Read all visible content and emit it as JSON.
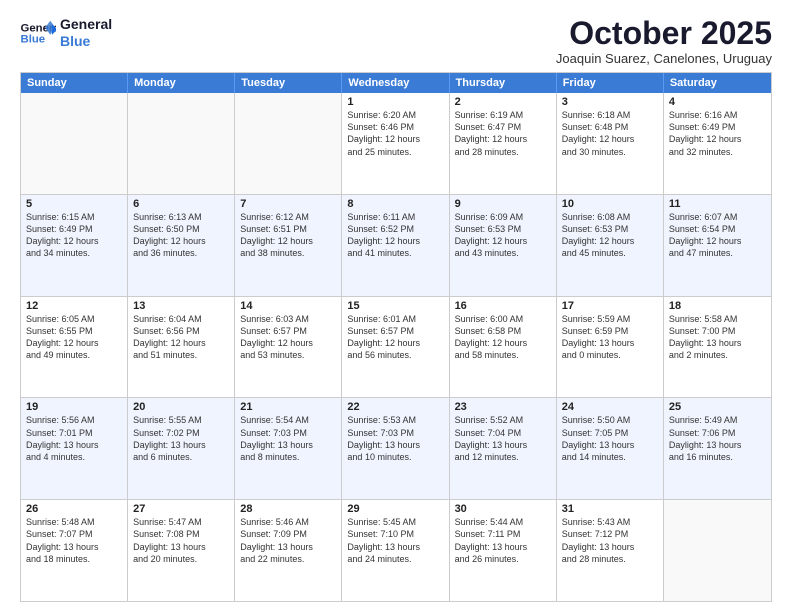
{
  "logo": {
    "line1": "General",
    "line2": "Blue"
  },
  "title": "October 2025",
  "subtitle": "Joaquin Suarez, Canelones, Uruguay",
  "header_days": [
    "Sunday",
    "Monday",
    "Tuesday",
    "Wednesday",
    "Thursday",
    "Friday",
    "Saturday"
  ],
  "weeks": [
    [
      {
        "day": "",
        "info": ""
      },
      {
        "day": "",
        "info": ""
      },
      {
        "day": "",
        "info": ""
      },
      {
        "day": "1",
        "info": "Sunrise: 6:20 AM\nSunset: 6:46 PM\nDaylight: 12 hours\nand 25 minutes."
      },
      {
        "day": "2",
        "info": "Sunrise: 6:19 AM\nSunset: 6:47 PM\nDaylight: 12 hours\nand 28 minutes."
      },
      {
        "day": "3",
        "info": "Sunrise: 6:18 AM\nSunset: 6:48 PM\nDaylight: 12 hours\nand 30 minutes."
      },
      {
        "day": "4",
        "info": "Sunrise: 6:16 AM\nSunset: 6:49 PM\nDaylight: 12 hours\nand 32 minutes."
      }
    ],
    [
      {
        "day": "5",
        "info": "Sunrise: 6:15 AM\nSunset: 6:49 PM\nDaylight: 12 hours\nand 34 minutes."
      },
      {
        "day": "6",
        "info": "Sunrise: 6:13 AM\nSunset: 6:50 PM\nDaylight: 12 hours\nand 36 minutes."
      },
      {
        "day": "7",
        "info": "Sunrise: 6:12 AM\nSunset: 6:51 PM\nDaylight: 12 hours\nand 38 minutes."
      },
      {
        "day": "8",
        "info": "Sunrise: 6:11 AM\nSunset: 6:52 PM\nDaylight: 12 hours\nand 41 minutes."
      },
      {
        "day": "9",
        "info": "Sunrise: 6:09 AM\nSunset: 6:53 PM\nDaylight: 12 hours\nand 43 minutes."
      },
      {
        "day": "10",
        "info": "Sunrise: 6:08 AM\nSunset: 6:53 PM\nDaylight: 12 hours\nand 45 minutes."
      },
      {
        "day": "11",
        "info": "Sunrise: 6:07 AM\nSunset: 6:54 PM\nDaylight: 12 hours\nand 47 minutes."
      }
    ],
    [
      {
        "day": "12",
        "info": "Sunrise: 6:05 AM\nSunset: 6:55 PM\nDaylight: 12 hours\nand 49 minutes."
      },
      {
        "day": "13",
        "info": "Sunrise: 6:04 AM\nSunset: 6:56 PM\nDaylight: 12 hours\nand 51 minutes."
      },
      {
        "day": "14",
        "info": "Sunrise: 6:03 AM\nSunset: 6:57 PM\nDaylight: 12 hours\nand 53 minutes."
      },
      {
        "day": "15",
        "info": "Sunrise: 6:01 AM\nSunset: 6:57 PM\nDaylight: 12 hours\nand 56 minutes."
      },
      {
        "day": "16",
        "info": "Sunrise: 6:00 AM\nSunset: 6:58 PM\nDaylight: 12 hours\nand 58 minutes."
      },
      {
        "day": "17",
        "info": "Sunrise: 5:59 AM\nSunset: 6:59 PM\nDaylight: 13 hours\nand 0 minutes."
      },
      {
        "day": "18",
        "info": "Sunrise: 5:58 AM\nSunset: 7:00 PM\nDaylight: 13 hours\nand 2 minutes."
      }
    ],
    [
      {
        "day": "19",
        "info": "Sunrise: 5:56 AM\nSunset: 7:01 PM\nDaylight: 13 hours\nand 4 minutes."
      },
      {
        "day": "20",
        "info": "Sunrise: 5:55 AM\nSunset: 7:02 PM\nDaylight: 13 hours\nand 6 minutes."
      },
      {
        "day": "21",
        "info": "Sunrise: 5:54 AM\nSunset: 7:03 PM\nDaylight: 13 hours\nand 8 minutes."
      },
      {
        "day": "22",
        "info": "Sunrise: 5:53 AM\nSunset: 7:03 PM\nDaylight: 13 hours\nand 10 minutes."
      },
      {
        "day": "23",
        "info": "Sunrise: 5:52 AM\nSunset: 7:04 PM\nDaylight: 13 hours\nand 12 minutes."
      },
      {
        "day": "24",
        "info": "Sunrise: 5:50 AM\nSunset: 7:05 PM\nDaylight: 13 hours\nand 14 minutes."
      },
      {
        "day": "25",
        "info": "Sunrise: 5:49 AM\nSunset: 7:06 PM\nDaylight: 13 hours\nand 16 minutes."
      }
    ],
    [
      {
        "day": "26",
        "info": "Sunrise: 5:48 AM\nSunset: 7:07 PM\nDaylight: 13 hours\nand 18 minutes."
      },
      {
        "day": "27",
        "info": "Sunrise: 5:47 AM\nSunset: 7:08 PM\nDaylight: 13 hours\nand 20 minutes."
      },
      {
        "day": "28",
        "info": "Sunrise: 5:46 AM\nSunset: 7:09 PM\nDaylight: 13 hours\nand 22 minutes."
      },
      {
        "day": "29",
        "info": "Sunrise: 5:45 AM\nSunset: 7:10 PM\nDaylight: 13 hours\nand 24 minutes."
      },
      {
        "day": "30",
        "info": "Sunrise: 5:44 AM\nSunset: 7:11 PM\nDaylight: 13 hours\nand 26 minutes."
      },
      {
        "day": "31",
        "info": "Sunrise: 5:43 AM\nSunset: 7:12 PM\nDaylight: 13 hours\nand 28 minutes."
      },
      {
        "day": "",
        "info": ""
      }
    ]
  ]
}
